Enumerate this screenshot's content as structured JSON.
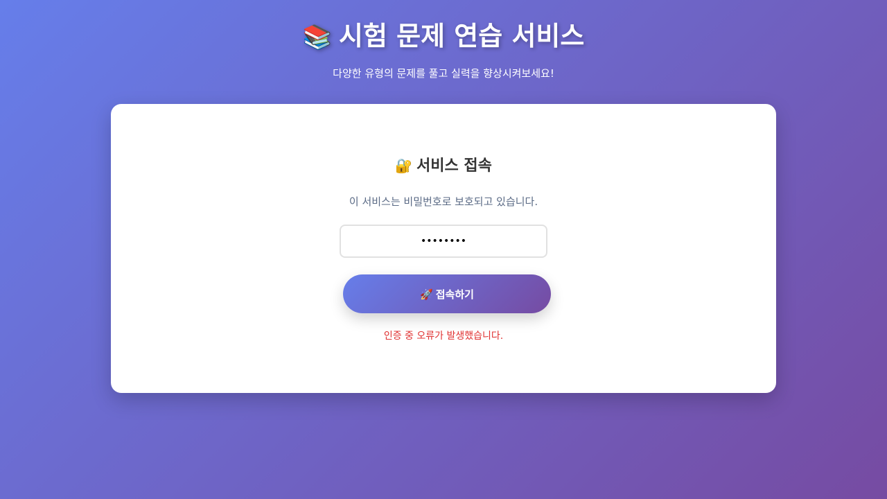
{
  "header": {
    "icon": "books-icon",
    "icon_glyph": "📚",
    "title": "시험 문제 연습 서비스",
    "subtitle": "다양한 유형의 문제를 풀고 실력을 향상시켜보세요!"
  },
  "login": {
    "icon": "lock-icon",
    "icon_glyph": "🔐",
    "title": "서비스 접속",
    "description": "이 서비스는 비밀번호로 보호되고 있습니다.",
    "password_value": "••••••••",
    "submit_icon": "rocket-icon",
    "submit_icon_glyph": "🚀",
    "submit_label": "접속하기",
    "error": "인증 중 오류가 발생했습니다."
  },
  "colors": {
    "gradient_start": "#667eea",
    "gradient_end": "#764ba2",
    "error": "#e03131"
  }
}
